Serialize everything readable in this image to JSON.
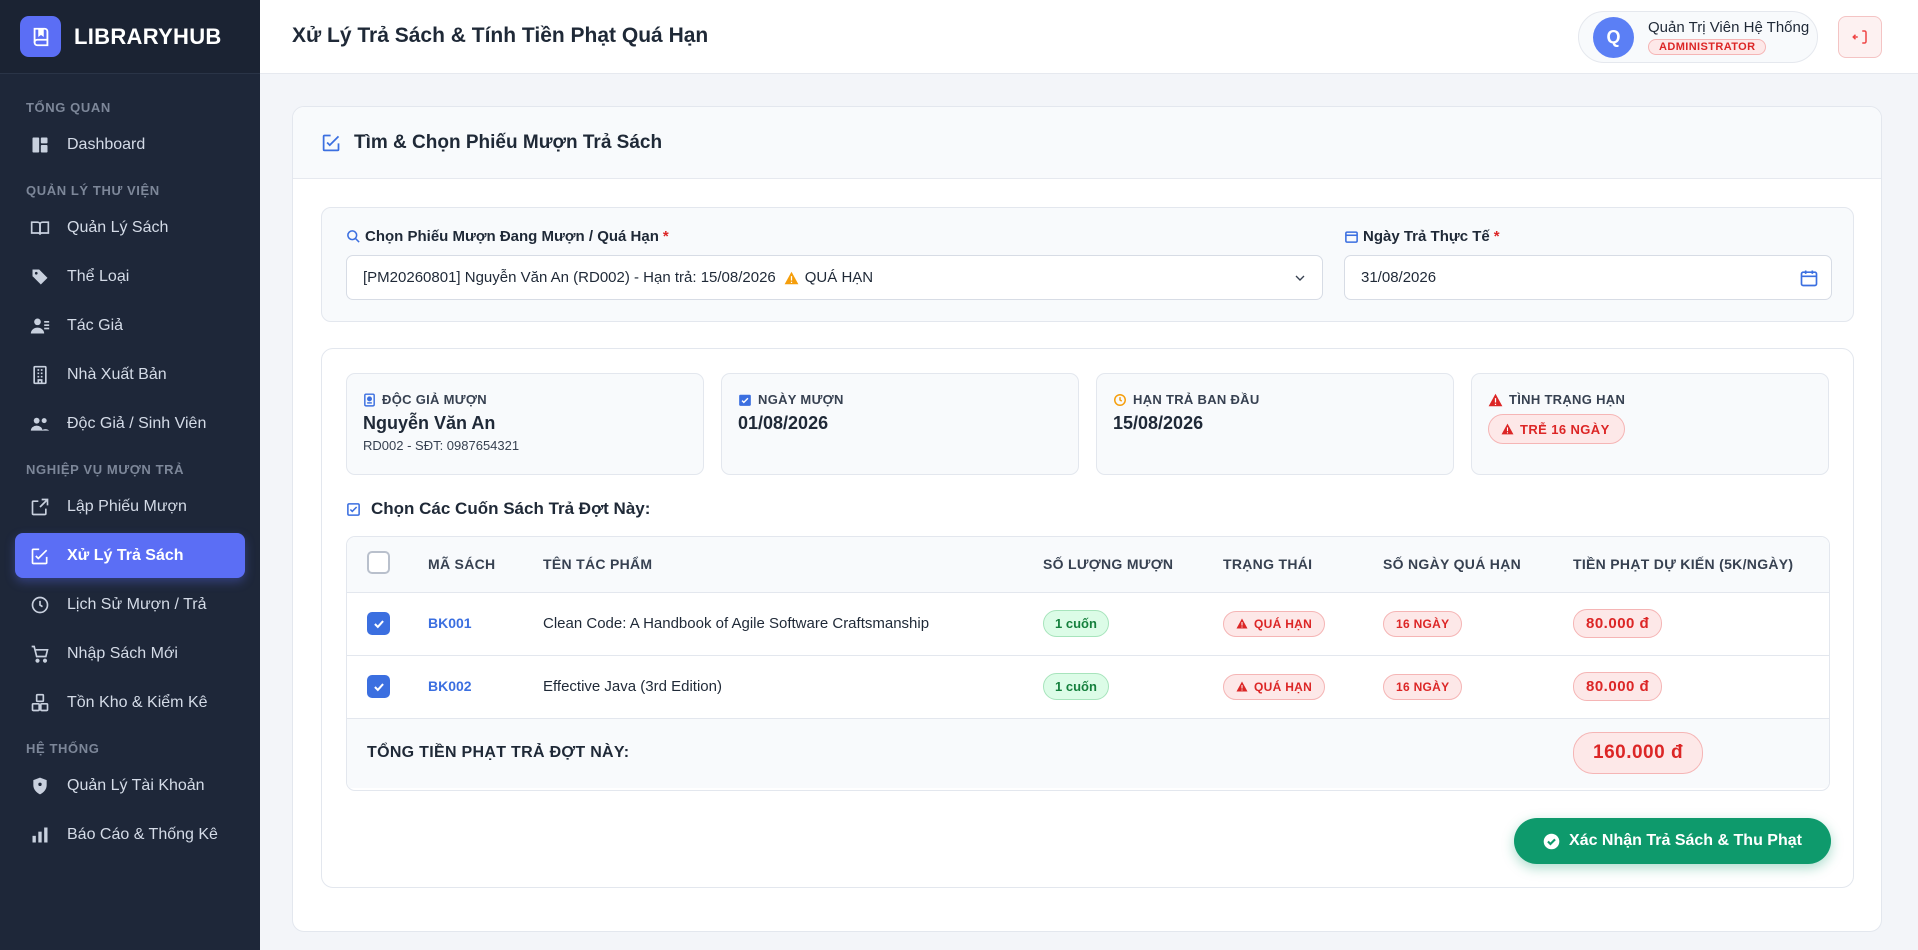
{
  "brand": {
    "name": "LIBRARYHUB"
  },
  "sidebar": {
    "sections": [
      {
        "title": "TỔNG QUAN",
        "items": [
          {
            "label": "Dashboard",
            "icon": "dashboard-icon"
          }
        ]
      },
      {
        "title": "QUẢN LÝ THƯ VIỆN",
        "items": [
          {
            "label": "Quản Lý Sách",
            "icon": "book-open-icon"
          },
          {
            "label": "Thể Loại",
            "icon": "tag-icon"
          },
          {
            "label": "Tác Giả",
            "icon": "user-pen-icon"
          },
          {
            "label": "Nhà Xuất Bản",
            "icon": "building-icon"
          },
          {
            "label": "Độc Giả / Sinh Viên",
            "icon": "users-icon"
          }
        ]
      },
      {
        "title": "NGHIỆP VỤ MƯỢN TRẢ",
        "items": [
          {
            "label": "Lập Phiếu Mượn",
            "icon": "external-link-icon"
          },
          {
            "label": "Xử Lý Trả Sách",
            "icon": "edit-square-icon",
            "active": true
          },
          {
            "label": "Lịch Sử Mượn / Trả",
            "icon": "clock-icon"
          },
          {
            "label": "Nhập Sách Mới",
            "icon": "cart-icon"
          },
          {
            "label": "Tồn Kho & Kiểm Kê",
            "icon": "boxes-icon"
          }
        ]
      },
      {
        "title": "HỆ THỐNG",
        "items": [
          {
            "label": "Quản Lý Tài Khoản",
            "icon": "shield-icon"
          },
          {
            "label": "Báo Cáo & Thống Kê",
            "icon": "bar-chart-icon"
          }
        ]
      }
    ]
  },
  "header": {
    "title": "Xử Lý Trả Sách & Tính Tiền Phạt Quá Hạn",
    "user": {
      "initial": "Q",
      "name": "Quản Trị Viên Hệ Thống",
      "role": "ADMINISTRATOR"
    }
  },
  "card": {
    "title": "Tìm & Chọn Phiếu Mượn Trả Sách"
  },
  "form": {
    "loan_label": "Chọn Phiếu Mượn Đang Mượn / Quá Hạn",
    "loan_value": "[PM20260801] Nguyễn Văn An (RD002) - Hạn trả: 15/08/2026",
    "loan_status": "QUÁ HẠN",
    "date_label": "Ngày Trả Thực Tế",
    "date_value": "31/08/2026",
    "required_mark": "*"
  },
  "info": {
    "reader": {
      "label": "ĐỘC GIẢ MƯỢN",
      "name": "Nguyễn Văn An",
      "sub": "RD002 - SĐT: 0987654321"
    },
    "borrow_date": {
      "label": "NGÀY MƯỢN",
      "value": "01/08/2026"
    },
    "due_date": {
      "label": "HẠN TRẢ BAN ĐẦU",
      "value": "15/08/2026"
    },
    "status": {
      "label": "TÌNH TRẠNG HẠN",
      "badge": "TRỄ 16 NGÀY"
    }
  },
  "books": {
    "title": "Chọn Các Cuốn Sách Trả Đợt Này:",
    "columns": [
      "MÃ SÁCH",
      "TÊN TÁC PHẨM",
      "SỐ LƯỢNG MƯỢN",
      "TRẠNG THÁI",
      "SỐ NGÀY QUÁ HẠN",
      "TIỀN PHẠT DỰ KIẾN (5K/NGÀY)"
    ],
    "rows": [
      {
        "code": "BK001",
        "title": "Clean Code: A Handbook of Agile Software Craftsmanship",
        "qty": "1 cuốn",
        "status": "QUÁ HẠN",
        "days": "16 NGÀY",
        "fine": "80.000 đ",
        "checked": true
      },
      {
        "code": "BK002",
        "title": "Effective Java (3rd Edition)",
        "qty": "1 cuốn",
        "status": "QUÁ HẠN",
        "days": "16 NGÀY",
        "fine": "80.000 đ",
        "checked": true
      }
    ],
    "total_label": "TỔNG TIỀN PHẠT TRẢ ĐỢT NÀY:",
    "total_value": "160.000 đ"
  },
  "actions": {
    "confirm_label": "Xác Nhận Trả Sách & Thu Phạt"
  },
  "colors": {
    "accent": "#5b6ef5",
    "sidebar_bg": "#1e2739",
    "danger": "#dc2626",
    "success": "#0e9a6c",
    "link": "#3b6fe0"
  }
}
